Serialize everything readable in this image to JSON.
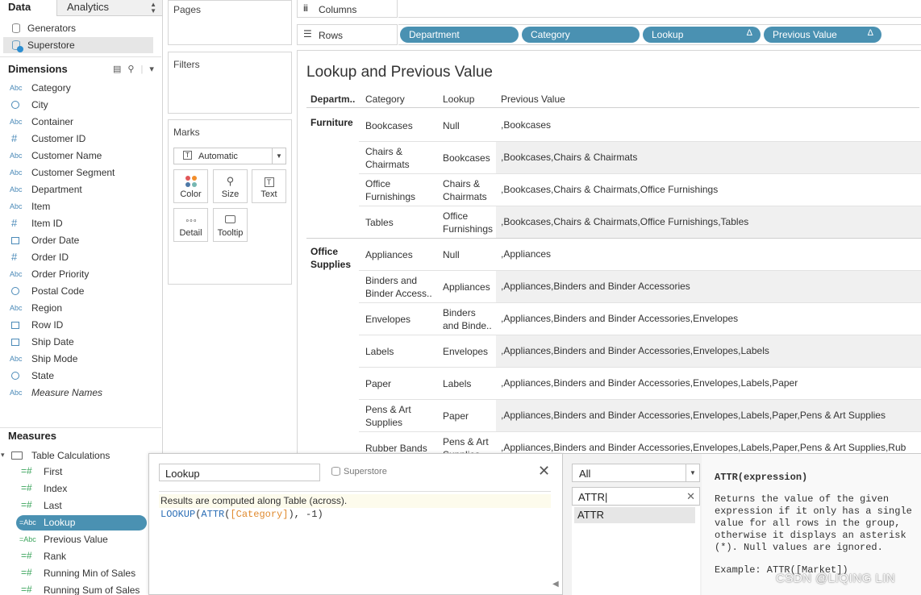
{
  "data_pane": {
    "tab_data": "Data",
    "tab_analytics": "Analytics",
    "datasources": [
      "Generators",
      "Superstore"
    ],
    "dimensions_header": "Dimensions",
    "dimensions": [
      {
        "icon": "abc-icon",
        "label": "Category"
      },
      {
        "icon": "globe-icon",
        "label": "City"
      },
      {
        "icon": "abc-icon",
        "label": "Container"
      },
      {
        "icon": "hash-icon",
        "label": "Customer ID"
      },
      {
        "icon": "abc-icon",
        "label": "Customer Name"
      },
      {
        "icon": "abc-icon",
        "label": "Customer Segment"
      },
      {
        "icon": "abc-icon",
        "label": "Department"
      },
      {
        "icon": "abc-icon",
        "label": "Item"
      },
      {
        "icon": "hash-icon",
        "label": "Item ID"
      },
      {
        "icon": "calendar-icon",
        "label": "Order Date"
      },
      {
        "icon": "hash-icon",
        "label": "Order ID"
      },
      {
        "icon": "abc-icon",
        "label": "Order Priority"
      },
      {
        "icon": "globe-icon",
        "label": "Postal Code"
      },
      {
        "icon": "abc-icon",
        "label": "Region"
      },
      {
        "icon": "calendar-icon",
        "label": "Row ID"
      },
      {
        "icon": "calendar-icon",
        "label": "Ship Date"
      },
      {
        "icon": "abc-icon",
        "label": "Ship Mode"
      },
      {
        "icon": "globe-icon",
        "label": "State"
      },
      {
        "icon": "abc-icon",
        "label": "Measure Names"
      }
    ],
    "measures_header": "Measures",
    "measures_folder": "Table Calculations",
    "measures": [
      {
        "icon": "=#",
        "label": "First"
      },
      {
        "icon": "=#",
        "label": "Index"
      },
      {
        "icon": "=#",
        "label": "Last"
      },
      {
        "icon": "=Abc",
        "label": "Lookup"
      },
      {
        "icon": "=Abc",
        "label": "Previous Value"
      },
      {
        "icon": "=#",
        "label": "Rank"
      },
      {
        "icon": "=#",
        "label": "Running Min of Sales"
      },
      {
        "icon": "=#",
        "label": "Running Sum of Sales"
      }
    ]
  },
  "cards": {
    "pages": "Pages",
    "filters": "Filters",
    "marks": "Marks",
    "mark_type": "Automatic",
    "mark_buttons": [
      "Color",
      "Size",
      "Text",
      "Detail",
      "Tooltip"
    ]
  },
  "shelves": {
    "columns": "Columns",
    "rows": "Rows",
    "row_pills": [
      "Department",
      "Category",
      "Lookup",
      "Previous Value"
    ],
    "delta": "Δ"
  },
  "view": {
    "title": "Lookup and Previous Value",
    "headers": [
      "Departm..",
      "Category",
      "Lookup",
      "Previous Value"
    ],
    "groups": [
      {
        "department": [
          "Furniture"
        ],
        "rows": [
          {
            "category": [
              "Bookcases"
            ],
            "lookup": [
              "Null"
            ],
            "previous": ",Bookcases"
          },
          {
            "category": [
              "Chairs &",
              "Chairmats"
            ],
            "lookup": [
              "Bookcases"
            ],
            "previous": ",Bookcases,Chairs & Chairmats"
          },
          {
            "category": [
              "Office",
              "Furnishings"
            ],
            "lookup": [
              "Chairs &",
              "Chairmats"
            ],
            "previous": ",Bookcases,Chairs & Chairmats,Office Furnishings"
          },
          {
            "category": [
              "Tables"
            ],
            "lookup": [
              "Office",
              "Furnishings"
            ],
            "previous": ",Bookcases,Chairs & Chairmats,Office Furnishings,Tables"
          }
        ]
      },
      {
        "department": [
          "Office",
          "Supplies"
        ],
        "rows": [
          {
            "category": [
              "Appliances"
            ],
            "lookup": [
              "Null"
            ],
            "previous": ",Appliances"
          },
          {
            "category": [
              "Binders and",
              "Binder Access.."
            ],
            "lookup": [
              "Appliances"
            ],
            "previous": ",Appliances,Binders and Binder Accessories"
          },
          {
            "category": [
              "Envelopes"
            ],
            "lookup": [
              "Binders",
              "and Binde.."
            ],
            "previous": ",Appliances,Binders and Binder Accessories,Envelopes"
          },
          {
            "category": [
              "Labels"
            ],
            "lookup": [
              "Envelopes"
            ],
            "previous": ",Appliances,Binders and Binder Accessories,Envelopes,Labels"
          },
          {
            "category": [
              "Paper"
            ],
            "lookup": [
              "Labels"
            ],
            "previous": ",Appliances,Binders and Binder Accessories,Envelopes,Labels,Paper"
          },
          {
            "category": [
              "Pens & Art",
              "Supplies"
            ],
            "lookup": [
              "Paper"
            ],
            "previous": ",Appliances,Binders and Binder Accessories,Envelopes,Labels,Paper,Pens & Art Supplies"
          },
          {
            "category": [
              "Rubber Bands"
            ],
            "lookup": [
              "Pens & Art",
              "Supplies"
            ],
            "previous": ",Appliances,Binders and Binder Accessories,Envelopes,Labels,Paper,Pens & Art Supplies,Rub"
          }
        ]
      }
    ]
  },
  "calc_editor": {
    "name": "Lookup",
    "source": "Superstore",
    "message": "Results are computed along Table (across).",
    "code_fn1": "LOOKUP",
    "code_p1": "(",
    "code_fn2": "ATTR",
    "code_p2": "(",
    "code_field": "[Category]",
    "code_tail": "), -1)"
  },
  "functions": {
    "category": "All",
    "search": "ATTR",
    "items": [
      "ATTR"
    ],
    "doc_signature": "ATTR(expression)",
    "doc_body": "Returns the value of the given expression if it only has a single value for all rows in the group, otherwise it displays an asterisk (*). Null values are ignored.",
    "doc_example": "Example: ATTR([Market])"
  },
  "watermark": "CSDN @LIQING LIN"
}
